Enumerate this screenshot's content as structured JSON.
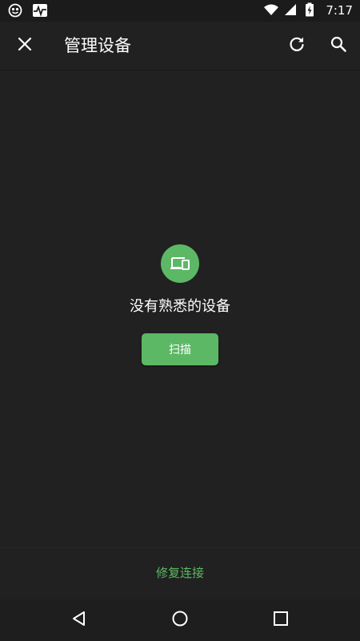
{
  "status_bar": {
    "time": "7:17",
    "left_icons": [
      "app-notification-icon",
      "activity-pulse-icon"
    ],
    "right_icons": [
      "wifi-icon",
      "signal-icon",
      "battery-icon"
    ]
  },
  "app_bar": {
    "title": "管理设备",
    "left_icon": "close-icon",
    "right_icons": [
      "refresh-icon",
      "search-icon"
    ]
  },
  "empty_state": {
    "icon": "devices-icon",
    "message": "没有熟悉的设备",
    "scan_label": "扫描"
  },
  "footer": {
    "repair_label": "修复连接"
  },
  "nav_bar": {
    "icons": [
      "back-icon",
      "home-icon",
      "recents-icon"
    ]
  },
  "colors": {
    "background": "#212121",
    "accent": "#5cb865",
    "text": "#ffffff"
  }
}
